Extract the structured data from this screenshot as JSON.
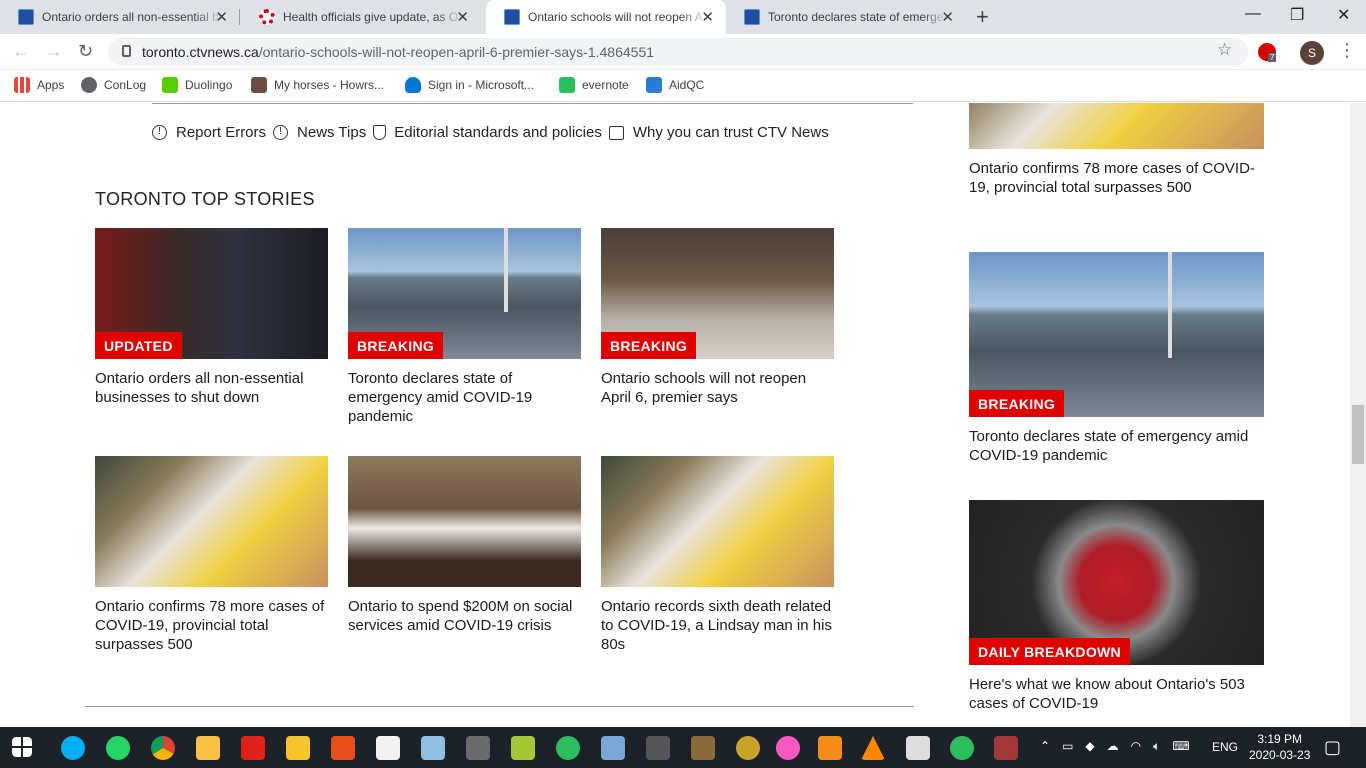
{
  "browser": {
    "tabs": [
      {
        "title": "Ontario orders all non-essential b",
        "favicon": "ctv-news-icon",
        "active": false
      },
      {
        "title": "Health officials give update, as O",
        "favicon": "cbc-icon",
        "active": false
      },
      {
        "title": "Ontario schools will not reopen A",
        "favicon": "ctv-news-icon",
        "active": true
      },
      {
        "title": "Toronto declares state of emerge",
        "favicon": "ctv-news-icon",
        "active": false
      }
    ],
    "new_tab_glyph": "+",
    "url_host": "toronto.ctvnews.ca",
    "url_path": "/ontario-schools-will-not-reopen-april-6-premier-says-1.4864551",
    "profile_initial": "S",
    "extension_badge": "7",
    "bookmarks": [
      {
        "label": "Apps",
        "icon": "apps-grid-icon",
        "color": "#e8453c"
      },
      {
        "label": "ConLog",
        "icon": "globe-icon",
        "color": "#5f6368"
      },
      {
        "label": "Duolingo",
        "icon": "duolingo-icon",
        "color": "#58cc02"
      },
      {
        "label": "My horses - Howrs...",
        "icon": "horse-icon",
        "color": "#6d4c41"
      },
      {
        "label": "Sign in - Microsoft...",
        "icon": "cloud-icon",
        "color": "#0078d4"
      },
      {
        "label": "evernote",
        "icon": "evernote-icon",
        "color": "#2dbe60"
      },
      {
        "label": "AidQC",
        "icon": "aidqc-icon",
        "color": "#2b7cd3"
      }
    ]
  },
  "page": {
    "footer_links": [
      {
        "label": "Report Errors",
        "icon": "info-circle-icon"
      },
      {
        "label": "News Tips",
        "icon": "info-circle-icon"
      },
      {
        "label": "Editorial standards and policies",
        "icon": "shield-check-icon"
      },
      {
        "label": "Why you can trust CTV News",
        "icon": "tv-icon"
      }
    ],
    "section_title": "TORONTO TOP STORIES",
    "stories": [
      {
        "badge": "UPDATED",
        "title": "Ontario orders all non-essential businesses to shut down",
        "image": "press-conference-photo"
      },
      {
        "badge": "BREAKING",
        "title": "Toronto declares state of emergency amid COVID-19 pandemic",
        "image": "toronto-skyline-photo"
      },
      {
        "badge": "BREAKING",
        "title": "Ontario schools will not reopen April 6, premier says",
        "image": "empty-classroom-photo"
      },
      {
        "badge": "",
        "title": "Ontario confirms 78 more cases of COVID-19, provincial total surpasses 500",
        "image": "test-kit-photo"
      },
      {
        "badge": "",
        "title": "Ontario to spend $200M on social services amid COVID-19 crisis",
        "image": "premier-desk-photo"
      },
      {
        "badge": "",
        "title": "Ontario records sixth death related to COVID-19, a Lindsay man in his 80s",
        "image": "test-kit-photo"
      }
    ],
    "sidebar": [
      {
        "badge": "",
        "title": "Ontario confirms 78 more cases of COVID-19, provincial total surpasses 500",
        "image": "test-kit-photo"
      },
      {
        "badge": "BREAKING",
        "title": "Toronto declares state of emergency amid COVID-19 pandemic",
        "image": "toronto-skyline-photo"
      },
      {
        "badge": "DAILY BREAKDOWN",
        "title": "Here's what we know about Ontario's 503 cases of COVID-19",
        "image": "coronavirus-illustration"
      }
    ]
  },
  "taskbar": {
    "language": "ENG",
    "time": "3:19 PM",
    "date": "2020-03-23"
  }
}
